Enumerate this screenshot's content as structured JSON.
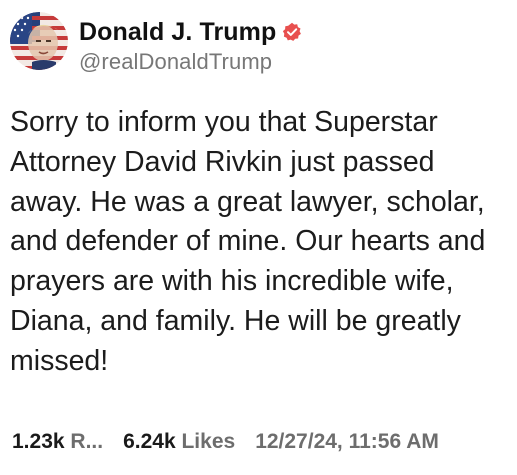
{
  "post": {
    "author": {
      "display_name": "Donald J. Trump",
      "handle": "@realDonaldTrump",
      "verified_icon": "verified-badge-icon",
      "verified_color": "#e8504f",
      "avatar_icon": "profile-avatar"
    },
    "body": "Sorry to inform you that Superstar Attorney David Rivkin just passed away. He was a great lawyer, scholar, and defender of mine. Our hearts and prayers are with his incredible wife, Diana, and family. He will be greatly missed!",
    "stats": {
      "retruths_count": "1.23k",
      "retruths_label": "R...",
      "likes_count": "6.24k",
      "likes_label": "Likes"
    },
    "timestamp": "12/27/24, 11:56 AM"
  }
}
